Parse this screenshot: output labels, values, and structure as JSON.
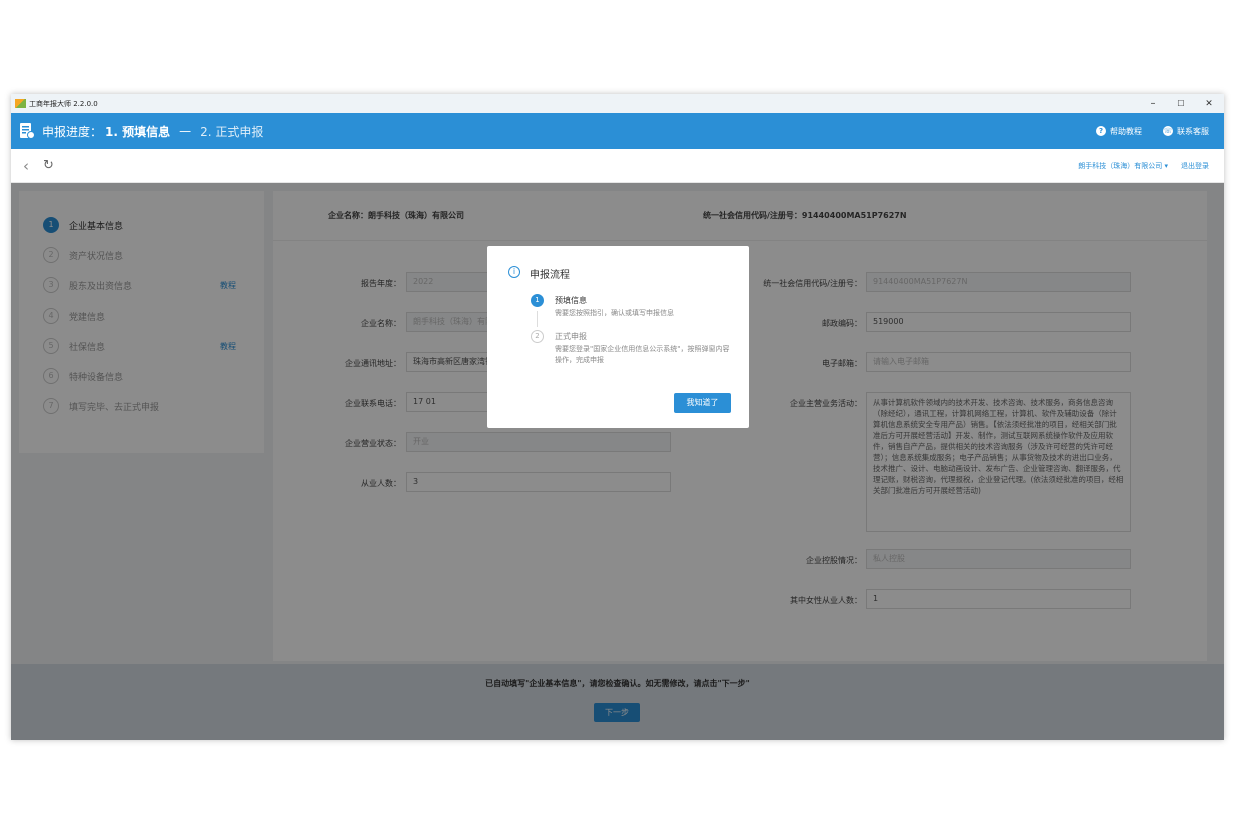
{
  "window": {
    "title": "工商年报大师 2.2.0.0",
    "controls": [
      "–",
      "☐",
      "✕"
    ]
  },
  "header": {
    "progress_label": "申报进度：",
    "step1": "1. 预填信息",
    "dash": "—",
    "step2": "2. 正式申报",
    "help": "帮助教程",
    "contact": "联系客服"
  },
  "nav": {
    "company": "朗手科技（珠海）有限公司",
    "logout": "退出登录"
  },
  "sidebar": {
    "steps": [
      {
        "num": "1",
        "label": "企业基本信息"
      },
      {
        "num": "2",
        "label": "资产状况信息"
      },
      {
        "num": "3",
        "label": "股东及出资信息"
      },
      {
        "num": "4",
        "label": "党建信息"
      },
      {
        "num": "5",
        "label": "社保信息"
      },
      {
        "num": "6",
        "label": "特种设备信息"
      },
      {
        "num": "7",
        "label": "填写完毕、去正式申报"
      }
    ],
    "tutorial": "教程"
  },
  "info": {
    "company_name": "企业名称：朗手科技（珠海）有限公司",
    "credit_code": "统一社会信用代码/注册号：91440400MA51P7627N"
  },
  "form": {
    "year_label": "报告年度：",
    "year_value": "2022",
    "name_label": "企业名称：",
    "name_value": "朗手科技（珠海）有限公司",
    "address_label": "企业通讯地址：",
    "address_value": "珠海市高新区唐家湾镇",
    "phone_label": "企业联系电话：",
    "phone_value": "17          01",
    "status_label": "企业营业状态：",
    "status_value": "开业",
    "employees_label": "从业人数：",
    "employees_value": "3",
    "code_label": "统一社会信用代码/注册号：",
    "code_value": "91440400MA51P7627N",
    "postal_label": "邮政编码：",
    "postal_value": "519000",
    "email_label": "电子邮箱：",
    "email_placeholder": "请输入电子邮箱",
    "business_label": "企业主营业务活动：",
    "business_value": "从事计算机软件领域内的技术开发、技术咨询、技术服务，商务信息咨询（除经纪），通讯工程，计算机网络工程，计算机、软件及辅助设备（除计算机信息系统安全专用产品）销售。【依法须经批准的项目，经相关部门批准后方可开展经营活动】开发、制作，测试互联网系统操作软件及应用软件，销售自产产品，提供相关的技术咨询服务（涉及许可经营的凭许可经营）；信息系统集成服务；电子产品销售；从事货物及技术的进出口业务，技术推广、设计、电脑动画设计、发布广告、企业管理咨询、翻译服务，代理记账，财税咨询，代理报税，企业登记代理。(依法须经批准的项目，经相关部门批准后方可开展经营活动)",
    "holding_label": "企业控股情况：",
    "holding_value": "私人控股",
    "female_label": "其中女性从业人数：",
    "female_value": "1"
  },
  "footer": {
    "message": "已自动填写\"企业基本信息\"，请您检查确认。如无需修改，请点击\"下一步\"",
    "next": "下一步"
  },
  "modal": {
    "title": "申报流程",
    "step1_num": "1",
    "step1_title": "预填信息",
    "step1_desc": "需要您按照指引，确认或填写申报信息",
    "step2_num": "2",
    "step2_title": "正式申报",
    "step2_desc": "需要您登录\"国家企业信用信息公示系统\"，按照弹窗内容操作，完成申报",
    "ok": "我知道了"
  }
}
